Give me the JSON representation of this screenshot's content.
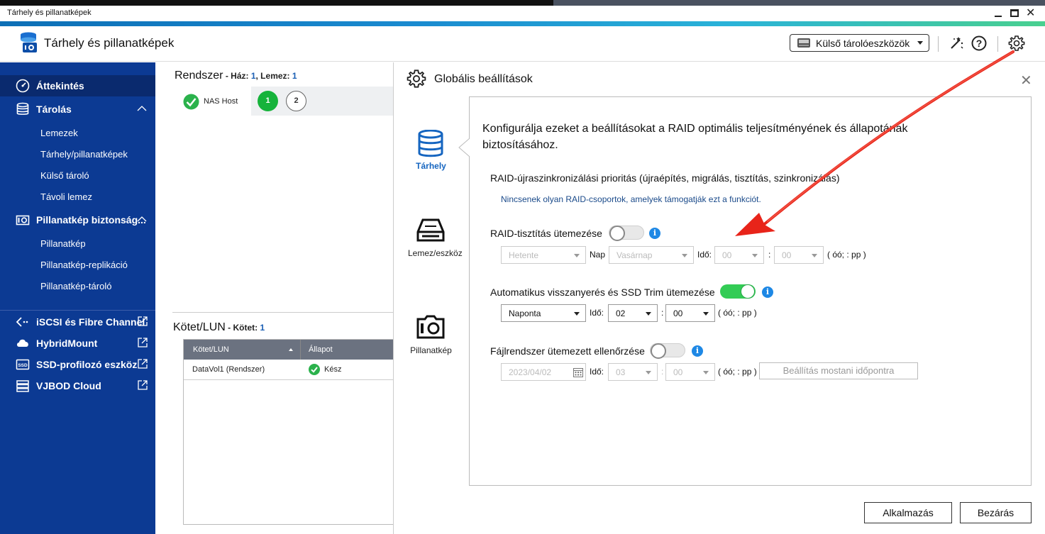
{
  "window": {
    "title": "Tárhely és pillanatképek"
  },
  "header": {
    "app_title": "Tárhely és pillanatképek",
    "external_dropdown": "Külső tárolóeszközök"
  },
  "sidebar": {
    "overview": "Áttekintés",
    "storage": "Tárolás",
    "storage_items": [
      "Lemezek",
      "Tárhely/pillanatképek",
      "Külső tároló",
      "Távoli lemez"
    ],
    "snapshot": "Pillanatkép biztonság...",
    "snapshot_items": [
      "Pillanatkép",
      "Pillanatkép-replikáció",
      "Pillanatkép-tároló"
    ],
    "links": [
      "iSCSI és Fibre Channel",
      "HybridMount",
      "SSD-profilozó eszköz",
      "VJBOD Cloud"
    ]
  },
  "system": {
    "title": "Rendszer",
    "hazlabel": " - Ház: ",
    "haz": "1",
    "lemezlabel": ", Lemez: ",
    "lemez": "1",
    "host": "NAS Host",
    "disks": [
      "1",
      "2"
    ]
  },
  "volumes": {
    "title": "Kötet/LUN",
    "countlabel": " - Kötet: ",
    "count": "1",
    "columns": [
      "Kötet/LUN",
      "Állapot"
    ],
    "rows": [
      {
        "name": "DataVol1 (Rendszer)",
        "status": "Kész"
      }
    ]
  },
  "dialog": {
    "title": "Globális beállítások",
    "tabs": [
      "Tárhely",
      "Lemez/eszköz",
      "Pillanatkép"
    ],
    "intro": "Konfigurálja ezeket a beállításokat a RAID optimális teljesítményének és állapotának biztosításához.",
    "resync_title": "RAID-újraszinkronizálási prioritás (újraépítés, migrálás, tisztítás, szinkronizálás)",
    "resync_note": "Nincsenek olyan RAID-csoportok, amelyek támogatják ezt a funkciót.",
    "scrub": {
      "title": "RAID-tisztítás ütemezése",
      "enabled": false,
      "freq": "Hetente",
      "day_label": "Nap",
      "day": "Vasárnap",
      "time_label": "Idő:",
      "hour": "00",
      "minute": "00",
      "hint": "( óó; : pp )"
    },
    "trim": {
      "title": "Automatikus visszanyerés és SSD Trim ütemezése",
      "enabled": true,
      "freq": "Naponta",
      "time_label": "Idő:",
      "hour": "02",
      "minute": "00",
      "hint": "( óó; : pp )"
    },
    "fscheck": {
      "title": "Fájlrendszer ütemezett ellenőrzése",
      "enabled": false,
      "date": "2023/04/02",
      "time_label": "Idő:",
      "hour": "03",
      "minute": "00",
      "hint": "( óó; : pp )",
      "set_now": "Beállítás mostani időpontra"
    },
    "colon": ":",
    "apply": "Alkalmazás",
    "close": "Bezárás"
  },
  "colors": {
    "sidebar": "#0c3a93",
    "accent": "#1565c0",
    "toggle_on": "#33cc55",
    "arrow": "#e8241a"
  },
  "icons": [
    "storage-app-logo",
    "hdd-icon",
    "wand-icon",
    "help-icon",
    "gear-icon",
    "dashboard-icon",
    "database-icon",
    "camera-icon",
    "external-link-icon",
    "calendar-icon",
    "info-icon"
  ]
}
